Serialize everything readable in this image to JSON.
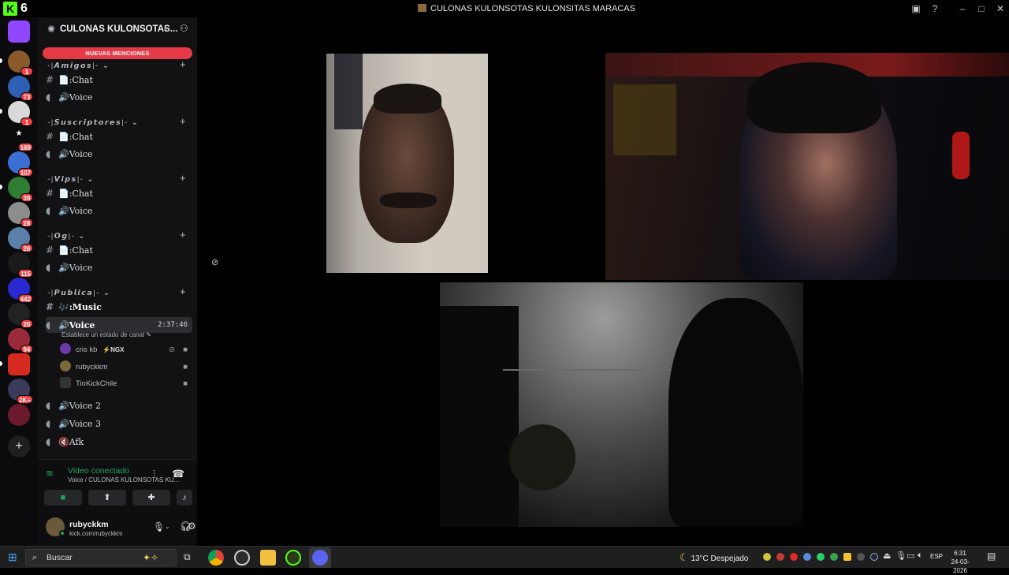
{
  "titlebar": {
    "app_number": "6",
    "window_title": "CULONAS KULONSOTAS KULONSITAS MARACAS"
  },
  "server_rail": {
    "badges": [
      "1",
      "73",
      "1",
      "169",
      "107",
      "39",
      "28",
      "26",
      "115",
      "442",
      "20",
      "94",
      "2K+"
    ]
  },
  "sidebar": {
    "server_name": "CULONAS KULONSOTAS...",
    "new_mentions": "NUEVAS MENCIONES",
    "categories": [
      {
        "name": "-|𝘼𝙢𝙞𝙜𝙤𝙨|-",
        "channels": [
          {
            "name": "📄:Chat"
          },
          {
            "name": "🔊Voice"
          }
        ]
      },
      {
        "name": "-|𝙎𝙪𝙨𝙘𝙧𝙞𝙥𝙩𝙤𝙧𝙚𝙨|-",
        "channels": [
          {
            "name": "📄:Chat"
          },
          {
            "name": "🔊Voice"
          }
        ]
      },
      {
        "name": "-|𝙑𝙞𝙥𝙨|-",
        "channels": [
          {
            "name": "📄:Chat"
          },
          {
            "name": "🔊Voice"
          }
        ]
      },
      {
        "name": "-|𝙊𝙜|-",
        "channels": [
          {
            "name": "📄:Chat"
          },
          {
            "name": "🔊Voice"
          }
        ]
      },
      {
        "name": "-|𝙋𝙪𝙗𝙡𝙞𝙘𝙖|-",
        "channels": [
          {
            "name": "🎶:Music"
          },
          {
            "name": "🔊Voice"
          }
        ]
      }
    ],
    "active_voice": {
      "timer": "2:37:46",
      "status_prompt": "Establece un estado de canal",
      "users": [
        {
          "name": "cris kb",
          "tag": "NGX"
        },
        {
          "name": "rubyckkm"
        },
        {
          "name": "TioKickChile"
        }
      ]
    },
    "extra_channels": [
      "🔊Voice 2",
      "🔊Voice 3",
      "🔇Afk"
    ]
  },
  "voice_panel": {
    "status": "Video conectado",
    "location": "Voice / CULONAS KULONSOTAS KU..."
  },
  "user_panel": {
    "username": "rubyckkm",
    "status": "kick.com/rubyckkm"
  },
  "taskbar": {
    "search_placeholder": "Buscar",
    "weather": "13°C  Despejado",
    "language": "ESP",
    "time": "6:31",
    "date": "24-03-2026"
  }
}
